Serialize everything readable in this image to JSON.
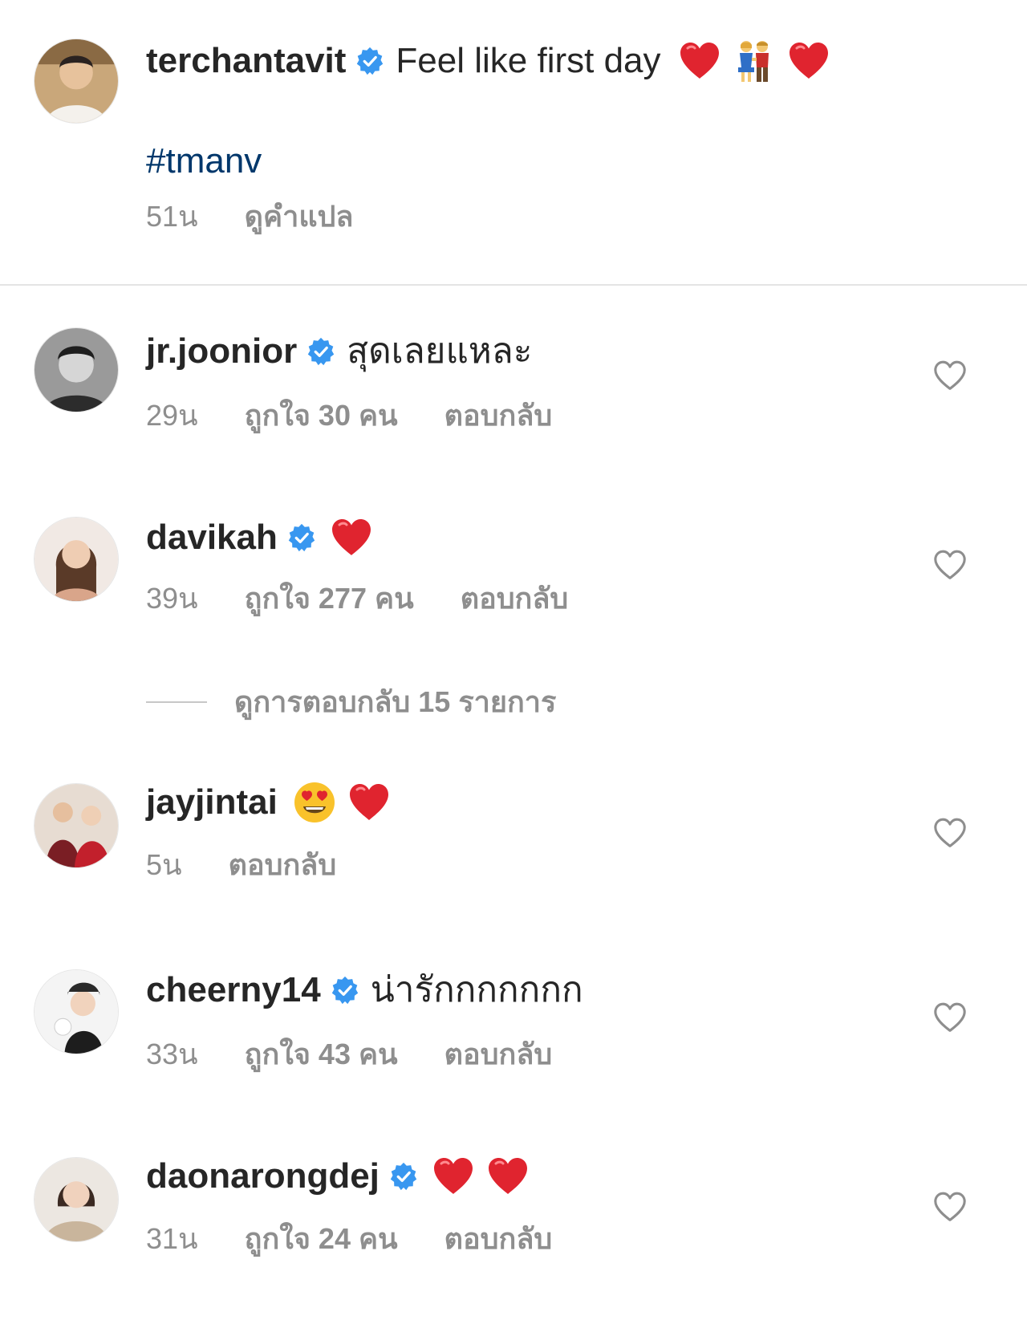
{
  "post": {
    "username": "terchantavit",
    "caption": "Feel like first day",
    "hashtag": "#tmanv",
    "time": "51น",
    "translate_label": "ดูคำแปล"
  },
  "comments": [
    {
      "username": "jr.joonior",
      "verified": true,
      "text": "สุดเลยแหละ",
      "time": "29น",
      "likes": "ถูกใจ 30 คน",
      "reply": "ตอบกลับ"
    },
    {
      "username": "davikah",
      "verified": true,
      "text": "",
      "emoji": [
        "heart"
      ],
      "time": "39น",
      "likes": "ถูกใจ 277 คน",
      "reply": "ตอบกลับ",
      "view_replies": "ดูการตอบกลับ 15 รายการ"
    },
    {
      "username": "jayjintai",
      "verified": false,
      "text": "",
      "emoji": [
        "heart-eyes",
        "heart"
      ],
      "time": "5น",
      "reply": "ตอบกลับ"
    },
    {
      "username": "cheerny14",
      "verified": true,
      "text": "น่ารักกกกกกก",
      "time": "33น",
      "likes": "ถูกใจ 43 คน",
      "reply": "ตอบกลับ"
    },
    {
      "username": "daonarongdej",
      "verified": true,
      "text": "",
      "emoji": [
        "heart",
        "heart"
      ],
      "time": "31น",
      "likes": "ถูกใจ 24 คน",
      "reply": "ตอบกลับ"
    }
  ],
  "colors": {
    "verified": "#3897f0",
    "heart": "#e0242f",
    "hashtag": "#00376b",
    "meta": "#8e8e8e"
  },
  "icons": {
    "verified": "verified-badge-icon",
    "like": "heart-outline-icon",
    "post_emoji": [
      "heart",
      "couple-holding-hands",
      "heart"
    ]
  }
}
